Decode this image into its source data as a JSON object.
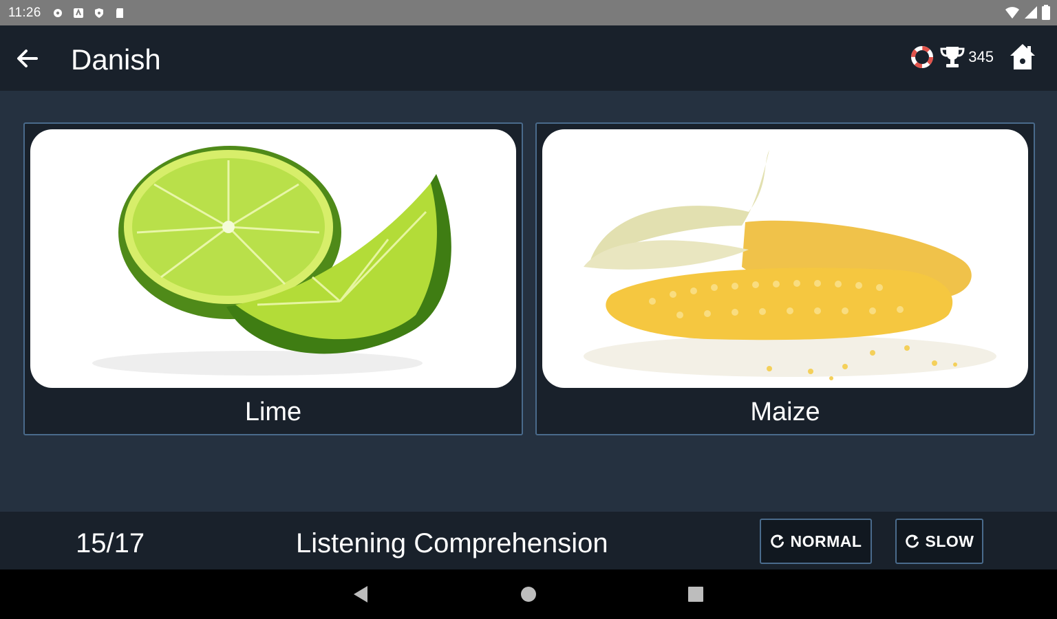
{
  "status_bar": {
    "time": "11:26"
  },
  "app_bar": {
    "title": "Danish",
    "score": "345"
  },
  "cards": [
    {
      "label": "Lime"
    },
    {
      "label": "Maize"
    }
  ],
  "bottom_bar": {
    "progress": "15/17",
    "mode": "Listening Comprehension",
    "normal_label": "NORMAL",
    "slow_label": "SLOW"
  },
  "colors": {
    "background": "#253140",
    "bar": "#19212b",
    "card_border": "#4a6b8c",
    "ring_accent": "#e2534b"
  }
}
